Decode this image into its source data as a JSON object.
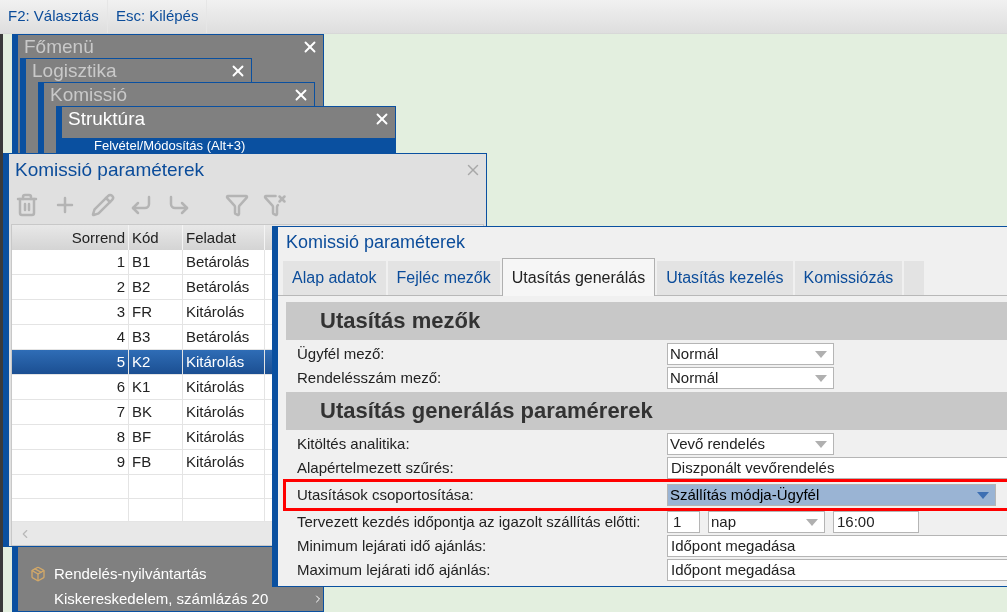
{
  "topbar": {
    "buttons": [
      "F2: Választás",
      "Esc: Kilépés"
    ]
  },
  "menu_windows": [
    {
      "title": "Főmenü",
      "active": false
    },
    {
      "title": "Logisztika",
      "active": false
    },
    {
      "title": "Komissió",
      "active": false
    },
    {
      "title": "Struktúra",
      "active": true
    }
  ],
  "structure_item": "Felvétel/Módosítás (Alt+3)",
  "menu_items": [
    {
      "label": "Rendelés-nyilvántartás",
      "kind": "icon"
    },
    {
      "label": "Kiskereskedelem, számlázás 20",
      "kind": "submenu"
    }
  ],
  "list_window": {
    "title": "Komissió paraméterek",
    "toolbar": [
      {
        "kind": "delete",
        "disabled": true
      },
      {
        "kind": "add",
        "disabled": true
      },
      {
        "kind": "edit",
        "disabled": true
      },
      {
        "kind": "move-left",
        "disabled": true
      },
      {
        "kind": "move-right",
        "disabled": true
      },
      {
        "kind": "filter",
        "disabled": true
      },
      {
        "kind": "filter-off",
        "disabled": true
      }
    ],
    "columns": [
      "Sorrend",
      "Kód",
      "Feladat"
    ],
    "rows": [
      {
        "cells": [
          "1",
          "B1",
          "Betárolás"
        ],
        "selected": false
      },
      {
        "cells": [
          "2",
          "B2",
          "Betárolás"
        ],
        "selected": false
      },
      {
        "cells": [
          "3",
          "FR",
          "Kitárolás"
        ],
        "selected": false
      },
      {
        "cells": [
          "4",
          "B3",
          "Betárolás"
        ],
        "selected": false
      },
      {
        "cells": [
          "5",
          "K2",
          "Kitárolás"
        ],
        "selected": true
      },
      {
        "cells": [
          "6",
          "K1",
          "Kitárolás"
        ],
        "selected": false
      },
      {
        "cells": [
          "7",
          "BK",
          "Kitárolás"
        ],
        "selected": false
      },
      {
        "cells": [
          "8",
          "BF",
          "Kitárolás"
        ],
        "selected": false
      },
      {
        "cells": [
          "9",
          "FB",
          "Kitárolás"
        ],
        "selected": false
      }
    ]
  },
  "dialog": {
    "title": "Komissió paraméterek",
    "tabs": [
      {
        "label": "Alap adatok",
        "selected": false
      },
      {
        "label": "Fejléc mezők",
        "selected": false
      },
      {
        "label": "Utasítás generálás",
        "selected": true
      },
      {
        "label": "Utasítás kezelés",
        "selected": false
      },
      {
        "label": "Komissiózás",
        "selected": false
      }
    ],
    "sections": [
      {
        "title": "Utasítás mezők",
        "rows": [
          {
            "label": "Ügyfél mező:",
            "highlighted": false,
            "fields": [
              {
                "kind": "select",
                "value": "Normál"
              }
            ]
          },
          {
            "label": "Rendelésszám mező:",
            "highlighted": false,
            "fields": [
              {
                "kind": "select",
                "value": "Normál"
              }
            ]
          }
        ]
      },
      {
        "title": "Utasítás generálás paramérerek",
        "rows": [
          {
            "label": "Kitöltés analitika:",
            "highlighted": false,
            "fields": [
              {
                "kind": "select",
                "value": "Vevő rendelés"
              }
            ]
          },
          {
            "label": "Alapértelmezett szűrés:",
            "highlighted": false,
            "fields": [
              {
                "kind": "text",
                "value": "Diszponált vevőrendelés"
              }
            ]
          },
          {
            "label": "Utasítások csoportosítása:",
            "highlighted": true,
            "fields": [
              {
                "kind": "select",
                "value": "Szállítás módja-Ügyfél"
              }
            ]
          },
          {
            "label": "Tervezett kezdés időpontja az igazolt szállítás előtti:",
            "highlighted": false,
            "fields": [
              {
                "kind": "number",
                "value": "1"
              },
              {
                "kind": "select",
                "value": "nap"
              },
              {
                "kind": "time",
                "value": "16:00"
              }
            ]
          },
          {
            "label": "Minimum lejárati idő ajánlás:",
            "highlighted": false,
            "fields": [
              {
                "kind": "text",
                "value": "Időpont megadása"
              }
            ]
          },
          {
            "label": "Maximum lejárati idő ajánlás:",
            "highlighted": false,
            "fields": [
              {
                "kind": "text",
                "value": "Időpont megadása"
              }
            ]
          }
        ]
      }
    ]
  }
}
